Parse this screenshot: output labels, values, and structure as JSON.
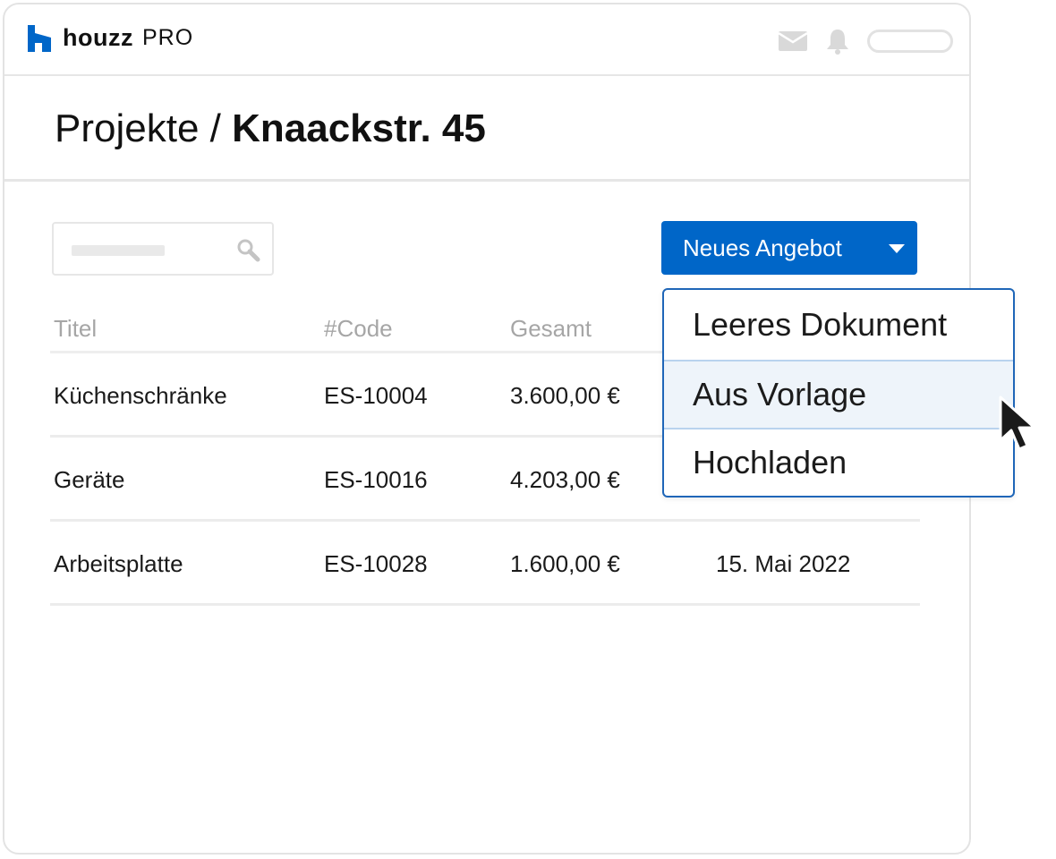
{
  "brand": {
    "name": "houzz",
    "suffix": "PRO",
    "color": "#0066c8"
  },
  "header": {
    "icons": [
      "mail-icon",
      "bell-icon"
    ]
  },
  "page": {
    "breadcrumb": "Projekte",
    "separator": " / ",
    "current": "Knaackstr. 45"
  },
  "toolbar": {
    "new_offer_label": "Neues Angebot",
    "accent": "#0066c8"
  },
  "dropdown": {
    "items": [
      {
        "label": "Leeres Dokument"
      },
      {
        "label": "Aus Vorlage",
        "hovered": true
      },
      {
        "label": "Hochladen"
      }
    ]
  },
  "table": {
    "columns": [
      "Titel",
      "#Code",
      "Gesamt"
    ],
    "rows": [
      {
        "title": "Küchenschränke",
        "code": "ES-10004",
        "total": "3.600,00 €",
        "date": ""
      },
      {
        "title": "Geräte",
        "code": "ES-10016",
        "total": "4.203,00 €",
        "date": ""
      },
      {
        "title": "Arbeitsplatte",
        "code": "ES-10028",
        "total": "1.600,00 €",
        "date": "15. Mai 2022"
      }
    ]
  }
}
